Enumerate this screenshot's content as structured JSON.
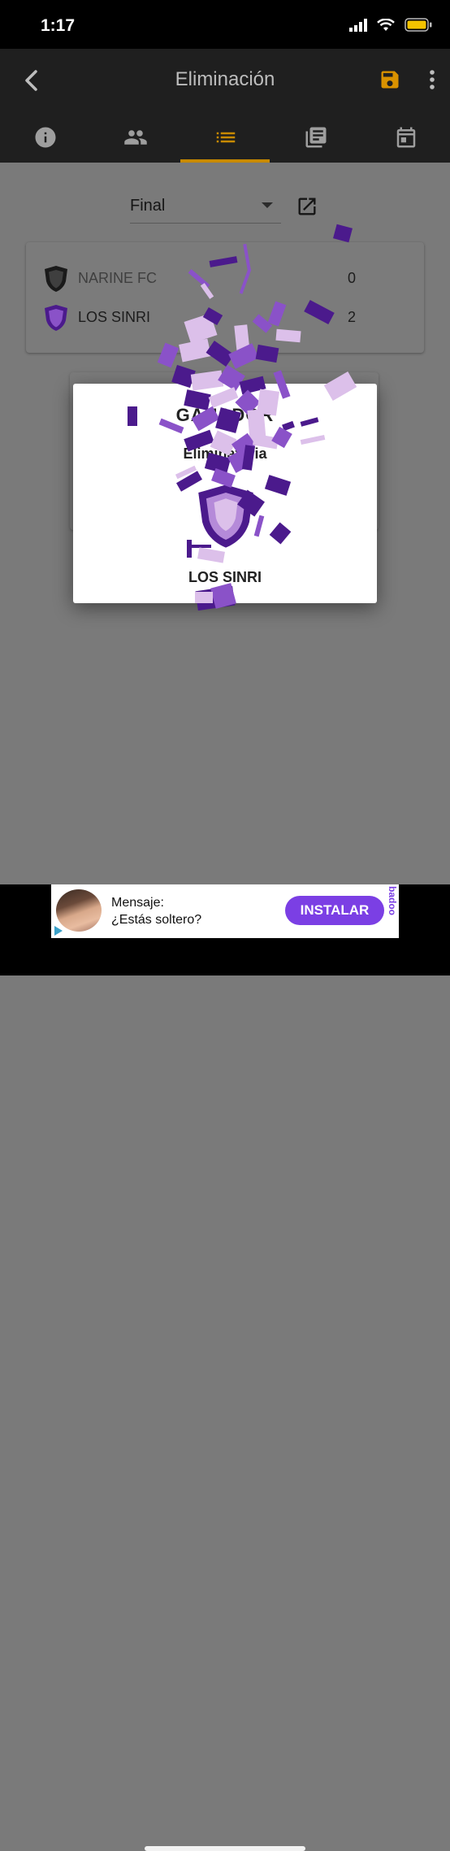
{
  "status_bar": {
    "time": "1:17"
  },
  "app_bar": {
    "title": "Eliminación"
  },
  "tabs": [
    {
      "name": "info-icon"
    },
    {
      "name": "people-icon"
    },
    {
      "name": "list-icon",
      "active": true
    },
    {
      "name": "library-books-icon"
    },
    {
      "name": "calendar-icon"
    }
  ],
  "round_select": {
    "value": "Final"
  },
  "match": {
    "teams": [
      {
        "name": "NARINE FC",
        "score": "0",
        "color": "#1a1a1a",
        "text_color": "#3f3f3f"
      },
      {
        "name": "LOS SINRI",
        "score": "2",
        "color": "#4b1a8c",
        "text_color": "#1c1c1c"
      }
    ]
  },
  "dialog": {
    "title": "GANADOR",
    "subtitle": "Eliminatoria",
    "team_name": "LOS SINRI"
  },
  "ad": {
    "line1": "Mensaje:",
    "line2": "¿Estás soltero?",
    "install_label": "INSTALAR",
    "brand": "badoo"
  },
  "colors": {
    "accent": "#c88a00",
    "purple_dark": "#4b1a8c",
    "purple_mid": "#8a52c8",
    "purple_light": "#dcc0ea",
    "install": "#7b3fe4"
  }
}
